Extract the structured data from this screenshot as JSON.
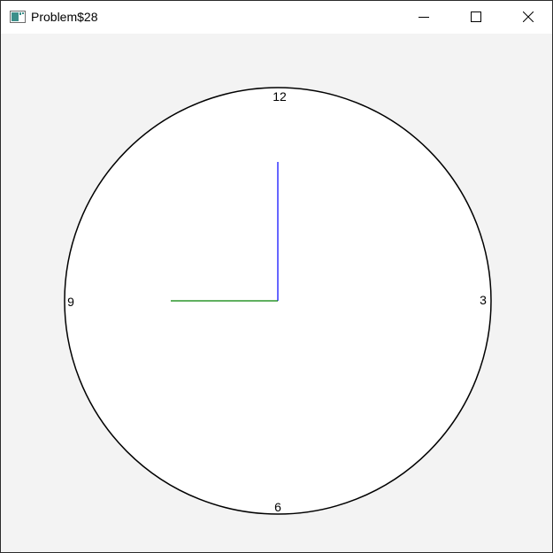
{
  "window": {
    "title": "Problem$28",
    "icon": "java-app-icon",
    "controls": {
      "minimize_icon": "minimize-icon",
      "maximize_icon": "maximize-icon",
      "close_icon": "close-icon"
    }
  },
  "clock": {
    "numerals": {
      "twelve": "12",
      "three": "3",
      "six": "6",
      "nine": "9"
    },
    "time": {
      "hour": 9,
      "minute": 0
    },
    "colors": {
      "face": "#ffffff",
      "outline": "#000000",
      "hour_hand": "#008000",
      "minute_hand": "#0000ff"
    }
  }
}
